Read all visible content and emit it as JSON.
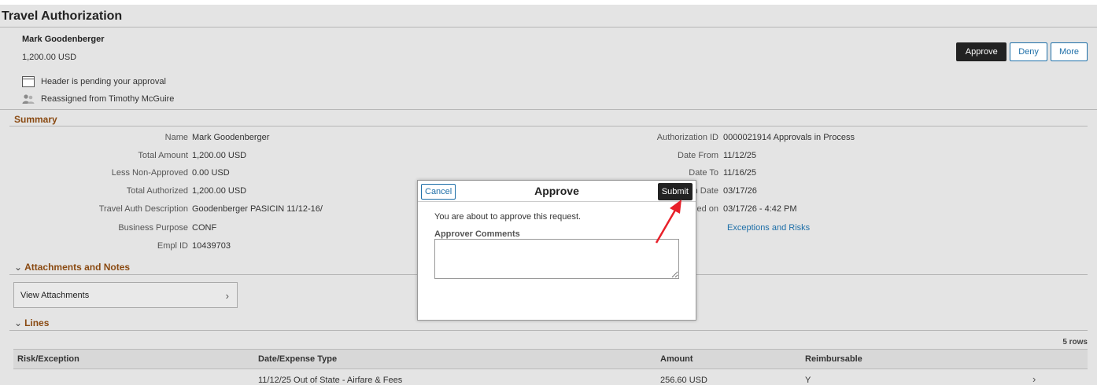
{
  "page": {
    "title": "Travel Authorization",
    "employee_name": "Mark Goodenberger",
    "amount": "1,200.00  USD",
    "status_pending": "Header is pending your approval",
    "status_reassigned": "Reassigned from Timothy McGuire"
  },
  "header_actions": {
    "approve": "Approve",
    "deny": "Deny",
    "more": "More"
  },
  "summary": {
    "title": "Summary",
    "left": [
      {
        "label": "Name",
        "value": "Mark Goodenberger"
      },
      {
        "label": "Total Amount",
        "value": "1,200.00  USD"
      },
      {
        "label": "Less Non-Approved",
        "value": "0.00  USD"
      },
      {
        "label": "Total Authorized",
        "value": "1,200.00  USD"
      },
      {
        "label": "Travel Auth Description",
        "value": "Goodenberger PASICIN 11/12-16/"
      },
      {
        "label": "Business Purpose",
        "value": "CONF"
      },
      {
        "label": "Empl ID",
        "value": "10439703"
      }
    ],
    "right": [
      {
        "label": "Authorization ID",
        "value": "0000021914  Approvals in Process"
      },
      {
        "label": "Date From",
        "value": "11/12/25"
      },
      {
        "label": "Date To",
        "value": "11/16/25"
      },
      {
        "label": "n Date",
        "value": "03/17/26"
      },
      {
        "label": "ed on",
        "value": "03/17/26 - 4:42 PM"
      }
    ],
    "exceptions_link": "Exceptions and Risks"
  },
  "attachments": {
    "title": "Attachments and Notes",
    "view_label": "View Attachments"
  },
  "lines": {
    "title": "Lines",
    "rows_count": "5 rows",
    "columns": [
      "Risk/Exception",
      "Date/Expense Type",
      "Amount",
      "Reimbursable"
    ],
    "rows": [
      {
        "risk": "",
        "date_type": "11/12/25   Out of State - Airfare & Fees",
        "amount": "256.60   USD",
        "reimbursable": "Y"
      }
    ]
  },
  "modal": {
    "title": "Approve",
    "cancel": "Cancel",
    "submit": "Submit",
    "message": "You are about to approve this request.",
    "comments_label": "Approver Comments",
    "comments_value": ""
  },
  "colors": {
    "section_title": "#8a4a12",
    "link": "#1e6fa8",
    "primary_button": "#222222",
    "arrow": "#e8202a"
  }
}
